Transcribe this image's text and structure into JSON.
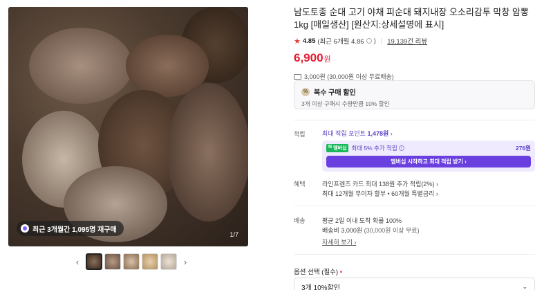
{
  "gallery": {
    "badge_text": "최근 3개월간 1,095명 재구매",
    "counter": "1/7",
    "thumbnails": 5
  },
  "product": {
    "title": "남도토종 순대 고기 야채 피순대 돼지내장 오소리감투 막창 암뽕 1kg [매일생산] [원산지:상세설명에 표시]",
    "rating": "4.85",
    "recent_rating": "(최근 6개월 4.86",
    "recent_rating_close": ")",
    "reviews": "19,139건 리뷰",
    "price": "6,900",
    "currency": "원",
    "shipping": "3,000원 (30,000원 이상 무료배송)"
  },
  "multi_discount": {
    "title": "복수 구매 할인",
    "description": "3개 이상 구매시 수량만큼 10% 할인",
    "icon": "%"
  },
  "points": {
    "label": "적립",
    "link_prefix": "최대 적립 포인트 ",
    "link_amount": "1,478원",
    "badge": "멤버십",
    "membership_text": "최대 5% 추가 적립",
    "membership_amount": "276원",
    "button": "멤버십 시작하고 최대 적립 받기"
  },
  "benefits": {
    "label": "혜택",
    "line1": "라인프렌즈 카드 최대 138원 추가 적립(2%)",
    "line2": "최대 12개월 무이자 할부 • 60개월 특별금리"
  },
  "delivery": {
    "label": "배송",
    "line1": "평균 2일 이내 도착 확률 100%",
    "line2_main": "배송비 3,000원",
    "line2_sub": " (30,000원 이상 무료)",
    "details_link": "자세히 보기"
  },
  "option": {
    "label": "옵션 선택 (필수)",
    "required_mark": "•",
    "selected": "3개 10%할인"
  },
  "colors": {
    "price": "#e5182e",
    "accent": "#6a3fe0",
    "star": "#e03a3a"
  }
}
